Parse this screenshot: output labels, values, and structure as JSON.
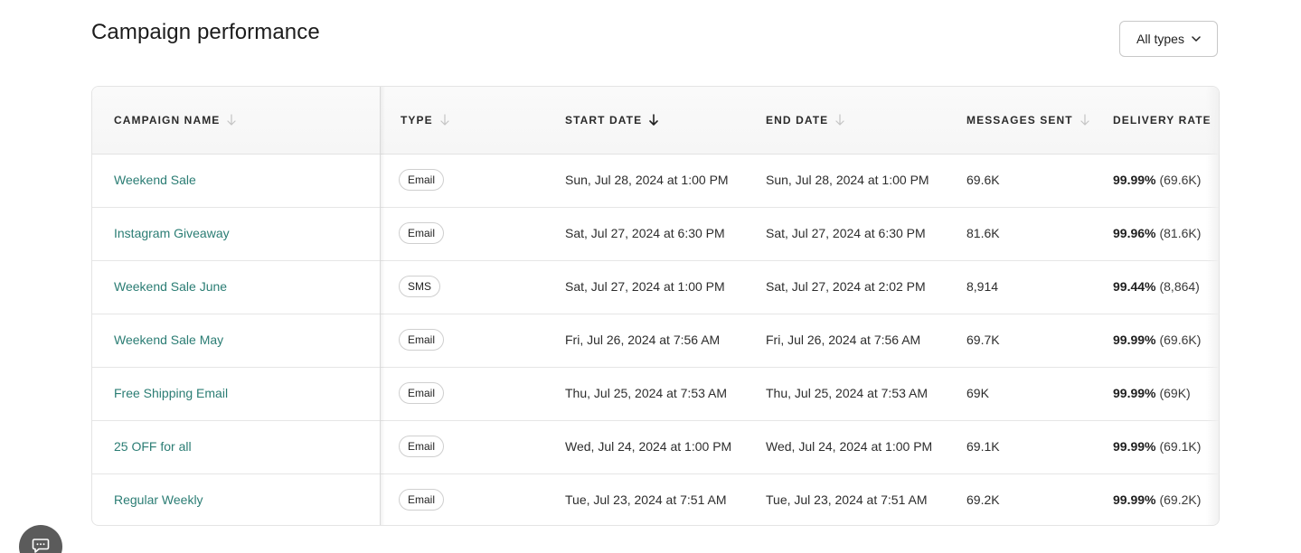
{
  "page": {
    "title": "Campaign performance",
    "filter": {
      "label": "All types"
    }
  },
  "table": {
    "columns": [
      {
        "key": "name",
        "label": "CAMPAIGN NAME",
        "sort": "none"
      },
      {
        "key": "type",
        "label": "TYPE",
        "sort": "none"
      },
      {
        "key": "start",
        "label": "START DATE",
        "sort": "desc-active"
      },
      {
        "key": "end",
        "label": "END DATE",
        "sort": "none"
      },
      {
        "key": "sent",
        "label": "MESSAGES SENT",
        "sort": "none"
      },
      {
        "key": "rate",
        "label": "DELIVERY RATE",
        "sort": "none"
      }
    ],
    "rows": [
      {
        "name": "Weekend Sale",
        "type": "Email",
        "start": "Sun, Jul 28, 2024 at 1:00 PM",
        "end": "Sun, Jul 28, 2024 at 1:00 PM",
        "sent": "69.6K",
        "rate_pct": "99.99%",
        "rate_count": "(69.6K)"
      },
      {
        "name": "Instagram Giveaway",
        "type": "Email",
        "start": "Sat, Jul 27, 2024 at 6:30 PM",
        "end": "Sat, Jul 27, 2024 at 6:30 PM",
        "sent": "81.6K",
        "rate_pct": "99.96%",
        "rate_count": "(81.6K)"
      },
      {
        "name": "Weekend Sale June",
        "type": "SMS",
        "start": "Sat, Jul 27, 2024 at 1:00 PM",
        "end": "Sat, Jul 27, 2024 at 2:02 PM",
        "sent": "8,914",
        "rate_pct": "99.44%",
        "rate_count": "(8,864)"
      },
      {
        "name": "Weekend Sale May",
        "type": "Email",
        "start": "Fri, Jul 26, 2024 at 7:56 AM",
        "end": "Fri, Jul 26, 2024 at 7:56 AM",
        "sent": "69.7K",
        "rate_pct": "99.99%",
        "rate_count": "(69.6K)"
      },
      {
        "name": "Free Shipping Email",
        "type": "Email",
        "start": "Thu, Jul 25, 2024 at 7:53 AM",
        "end": "Thu, Jul 25, 2024 at 7:53 AM",
        "sent": "69K",
        "rate_pct": "99.99%",
        "rate_count": "(69K)"
      },
      {
        "name": "25 OFF for all",
        "type": "Email",
        "start": "Wed, Jul 24, 2024 at 1:00 PM",
        "end": "Wed, Jul 24, 2024 at 1:00 PM",
        "sent": "69.1K",
        "rate_pct": "99.99%",
        "rate_count": "(69.1K)"
      },
      {
        "name": "Regular Weekly",
        "type": "Email",
        "start": "Tue, Jul 23, 2024 at 7:51 AM",
        "end": "Tue, Jul 23, 2024 at 7:51 AM",
        "sent": "69.2K",
        "rate_pct": "99.99%",
        "rate_count": "(69.2K)"
      }
    ]
  },
  "icons": {
    "filter_chevron": "chevron-down-icon",
    "sort_inactive": "arrow-down-light-icon",
    "sort_active": "arrow-down-dark-icon",
    "chat": "chat-bubble-icon"
  },
  "colors": {
    "link": "#2b7d74",
    "chat_button": "#5b5b5b"
  }
}
